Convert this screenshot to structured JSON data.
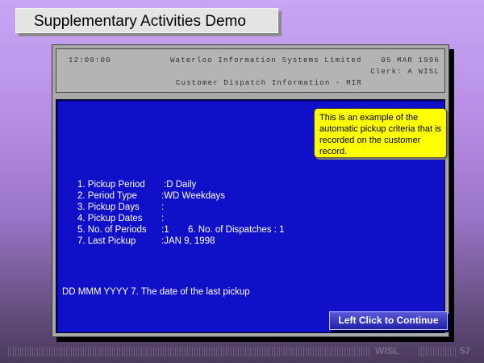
{
  "title": "Supplementary Activities Demo",
  "terminal": {
    "time": "12:00:00",
    "company": "Waterloo Information Systems Limited",
    "date": "05 MAR 1996",
    "clerk": "Clerk: A WISL",
    "screen_title": "Customer Dispatch Information - MIR"
  },
  "callout": "This is an example of the automatic pickup criteria that is recorded on the customer record.",
  "fields": [
    {
      "label": "1. Pickup Period",
      "value": ":D Daily"
    },
    {
      "label": "2. Period Type",
      "value": ":WD Weekdays"
    },
    {
      "label": "3. Pickup Days",
      "value": ":"
    },
    {
      "label": "4. Pickup Dates",
      "value": ":"
    },
    {
      "label": "5. No. of Periods",
      "value": ":1",
      "extra": "6. No. of Dispatches : 1"
    },
    {
      "label": "7. Last Pickup",
      "value": ":JAN 9, 1998"
    }
  ],
  "hint": "DD MMM YYYY 7. The date of the last pickup",
  "continue_label": "Left Click to Continue",
  "footer": {
    "brand": "WISL",
    "page": "57"
  }
}
